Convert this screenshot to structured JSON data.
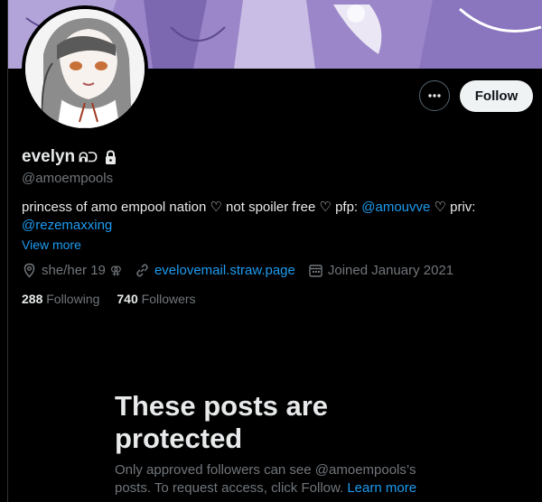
{
  "profile": {
    "name": "evelyn",
    "name_glyph": "ᕱᑐ",
    "handle": "@amoempools",
    "bio_text": "princess of amo empool nation ♡ not spoiler free ♡ pfp: ",
    "bio_mention1": "@amouvve",
    "bio_mid": " ♡ priv: ",
    "bio_mention2": "@rezemaxxing",
    "view_more": "View more",
    "pronouns": "she/her 19",
    "pronoun_glyph": "⚢",
    "website": "evelovemail.straw.page",
    "joined": "Joined January 2021",
    "following_count": "288",
    "following_label": "Following",
    "followers_count": "740",
    "followers_label": "Followers"
  },
  "actions": {
    "follow_label": "Follow",
    "more_icon": "more-dots-icon"
  },
  "protected": {
    "title": "These posts are protected",
    "desc": "Only approved followers can see @amoempools’s posts. To request access, click Follow. ",
    "learn_more": "Learn more"
  },
  "colors": {
    "accent": "#1d9bf0",
    "banner": "#9a86c8",
    "muted": "#71767b"
  }
}
